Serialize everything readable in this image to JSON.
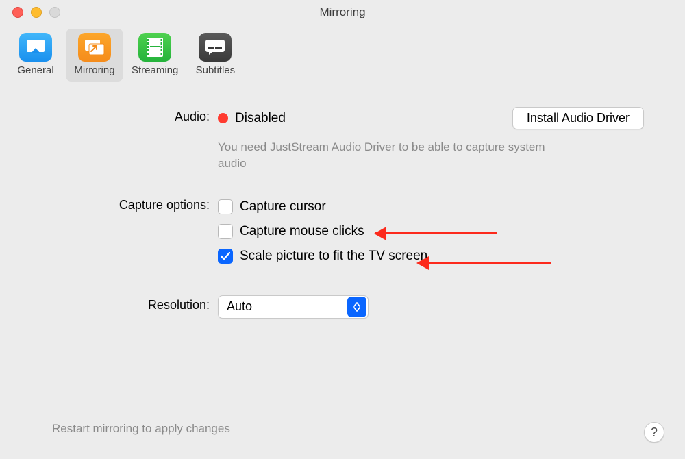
{
  "window": {
    "title": "Mirroring"
  },
  "tabs": [
    {
      "label": "General"
    },
    {
      "label": "Mirroring"
    },
    {
      "label": "Streaming"
    },
    {
      "label": "Subtitles"
    }
  ],
  "active_tab_index": 1,
  "audio": {
    "label": "Audio:",
    "status_text": "Disabled",
    "status_color": "#ff3b30",
    "install_button": "Install Audio Driver",
    "hint": "You need JustStream Audio Driver to be able to capture system audio"
  },
  "capture": {
    "label": "Capture options:",
    "options": [
      {
        "label": "Capture cursor",
        "checked": false
      },
      {
        "label": "Capture mouse clicks",
        "checked": false
      },
      {
        "label": "Scale picture to fit the TV screen",
        "checked": true
      }
    ]
  },
  "resolution": {
    "label": "Resolution:",
    "value": "Auto"
  },
  "footer_note": "Restart mirroring to apply changes",
  "help_symbol": "?",
  "colors": {
    "accent": "#0a66ff",
    "annotation": "#fc2a1c"
  }
}
